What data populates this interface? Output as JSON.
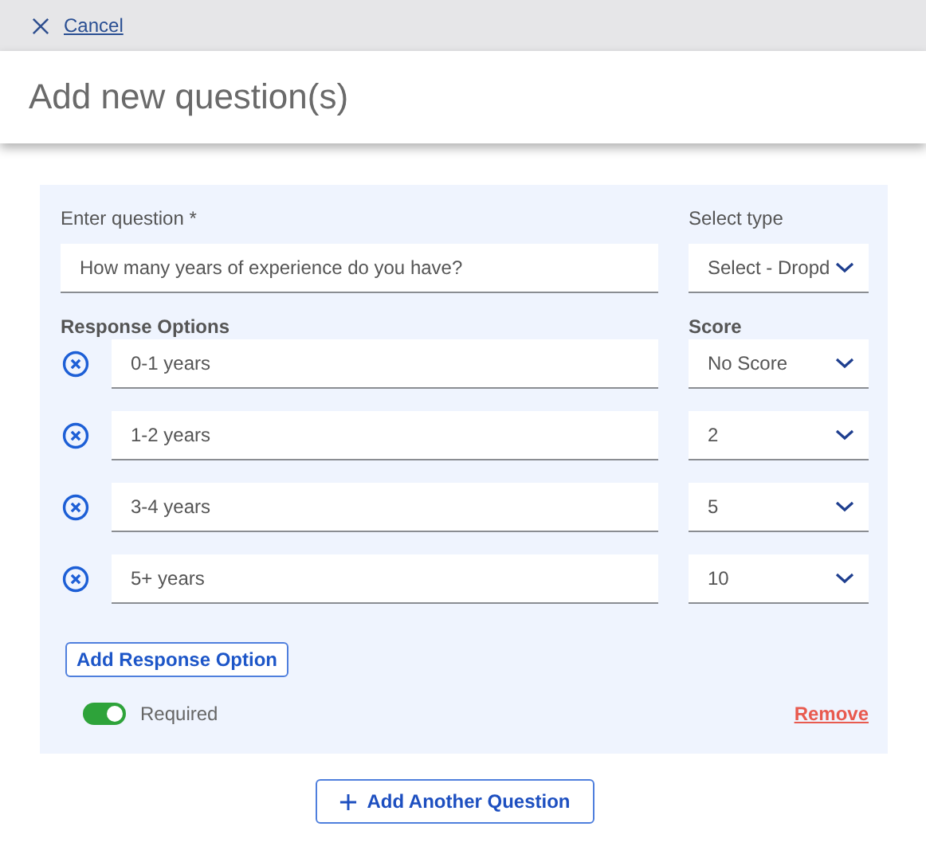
{
  "top_bar": {
    "cancel": "Cancel"
  },
  "title": "Add new question(s)",
  "question": {
    "label": "Enter question *",
    "value": "How many years of experience do you have?",
    "type_label": "Select type",
    "type_value": "Select - Dropd"
  },
  "responses_label": "Response Options",
  "score_label": "Score",
  "responses": [
    {
      "text": "0-1 years",
      "score": "No Score"
    },
    {
      "text": "1-2 years",
      "score": "2"
    },
    {
      "text": "3-4 years",
      "score": "5"
    },
    {
      "text": "5+ years",
      "score": "10"
    }
  ],
  "add_response": "Add Response Option",
  "required": {
    "label": "Required",
    "on": true
  },
  "remove": "Remove",
  "add_question": "Add Another Question"
}
